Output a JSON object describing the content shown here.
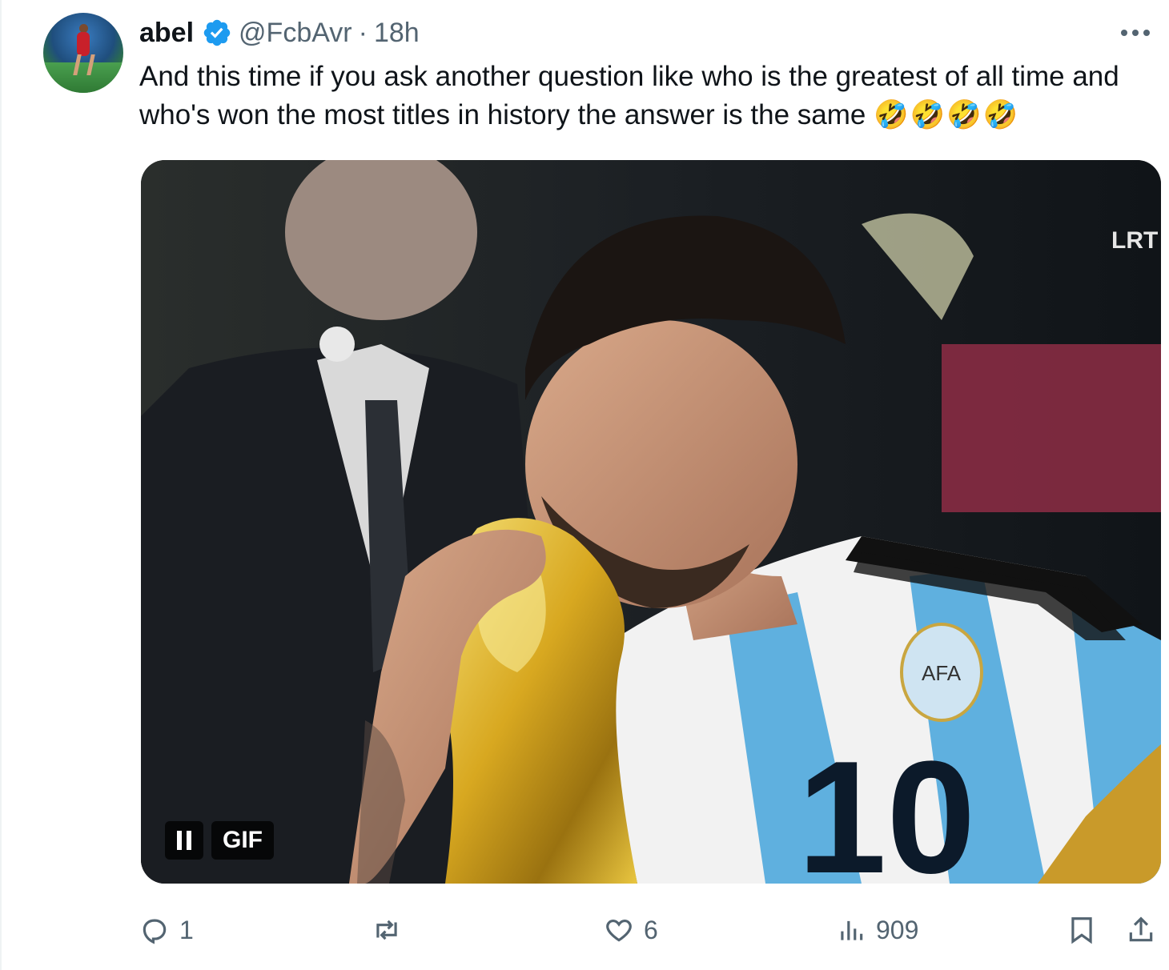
{
  "author": {
    "display_name": "abel",
    "handle": "@FcbAvr",
    "separator": "·",
    "time": "18h",
    "avatar_icon": "player-avatar",
    "verified_icon": "verified-badge-icon"
  },
  "tweet": {
    "text": "And this time if you ask another question like who is the greatest of all time and who's won the most titles in history the answer is the same",
    "emoji": "🤣🤣🤣🤣"
  },
  "media": {
    "badge": "GIF",
    "watermark": "LRT",
    "jersey_number": "10",
    "crest_text": "AFA"
  },
  "actions": {
    "reply_count": "1",
    "repost_count": "",
    "like_count": "6",
    "views_count": "909"
  },
  "colors": {
    "text_primary": "#0f1419",
    "text_secondary": "#536471",
    "verified_blue": "#1d9bf0",
    "border": "#eff3f4"
  }
}
